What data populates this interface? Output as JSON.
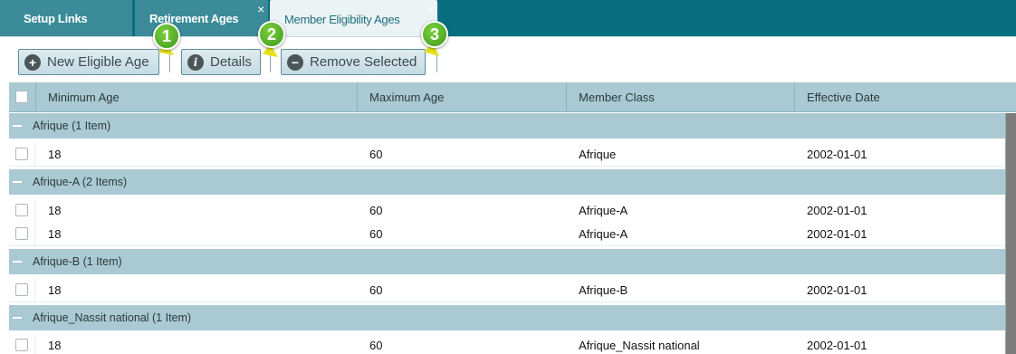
{
  "tabs": [
    {
      "label": "Setup Links",
      "closable": false
    },
    {
      "label": "Retirement Ages",
      "closable": true
    },
    {
      "label": "Member Eligibility Ages",
      "closable": true,
      "active": true
    }
  ],
  "toolbar": {
    "new_label": "New Eligible Age",
    "details_label": "Details",
    "remove_label": "Remove Selected"
  },
  "callouts": [
    "1",
    "2",
    "3"
  ],
  "grid": {
    "columns": [
      "Minimum Age",
      "Maximum Age",
      "Member Class",
      "Effective Date"
    ],
    "groups": [
      {
        "label": "Afrique (1 Item)",
        "rows": [
          [
            "18",
            "60",
            "Afrique",
            "2002-01-01"
          ]
        ]
      },
      {
        "label": "Afrique-A (2 Items)",
        "rows": [
          [
            "18",
            "60",
            "Afrique-A",
            "2002-01-01"
          ],
          [
            "18",
            "60",
            "Afrique-A",
            "2002-01-01"
          ]
        ]
      },
      {
        "label": "Afrique-B (1 Item)",
        "rows": [
          [
            "18",
            "60",
            "Afrique-B",
            "2002-01-01"
          ]
        ]
      },
      {
        "label": "Afrique_Nassit national (1 Item)",
        "rows": [
          [
            "18",
            "60",
            "Afrique_Nassit national",
            "2002-01-01"
          ]
        ]
      }
    ]
  },
  "icons": {
    "tab_close": "×",
    "new": "+",
    "details": "i",
    "remove": "−",
    "group_collapse": "minus-icon"
  },
  "colors": {
    "tab_bar": "#086e80",
    "grid_header": "#a9cad3",
    "callout": "#4fae26",
    "pointer": "#e5e31a"
  }
}
